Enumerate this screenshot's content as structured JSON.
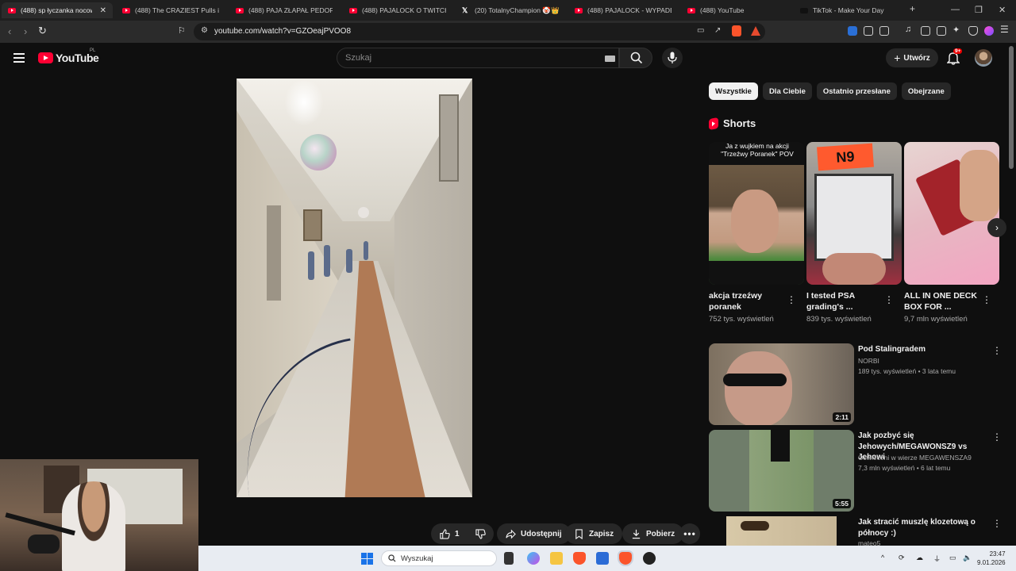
{
  "browser": {
    "tabs": [
      {
        "label": "(488) sp łyczanka nocowan",
        "active": true,
        "icon": "youtube-icon"
      },
      {
        "label": "(488) The CRAZIEST Pulls in TC",
        "icon": "youtube-icon"
      },
      {
        "label": "(488) PAJA ZŁAPAŁ PEDOFILA",
        "icon": "youtube-icon"
      },
      {
        "label": "(488) PAJALOCK O TWITCH.TV",
        "icon": "youtube-icon"
      },
      {
        "label": "(20) TotalnyChampion 🤡👑 o",
        "icon": "x-icon"
      },
      {
        "label": "(488) PAJALOCK - WYPADEK N",
        "icon": "youtube-icon"
      },
      {
        "label": "(488) YouTube",
        "icon": "youtube-icon"
      },
      {
        "label": "TikTok - Make Your Day",
        "icon": "tiktok-icon"
      }
    ],
    "new_tab": "+",
    "url": "youtube.com/watch?v=GZOeajPVOO8"
  },
  "youtube": {
    "logo_text": "YouTube",
    "country_code": "PL",
    "search_placeholder": "Szukaj",
    "create_label": "Utwórz",
    "notifications_badge": "9+"
  },
  "video": {
    "likes": "1",
    "actions": {
      "share": "Udostępnij",
      "save": "Zapisz",
      "download": "Pobierz"
    }
  },
  "sidebar": {
    "chips": [
      "Wszystkie",
      "Dla Ciebie",
      "Ostatnio przesłane",
      "Obejrzane"
    ],
    "active_chip": "Wszystkie",
    "shorts_title": "Shorts",
    "shorts": [
      {
        "title": "akcja trzeźwy poranek",
        "views": "752 tys. wyświetleń",
        "overlay": "Ja z wujkiem na akcji \"Trzeźwy Poranek\" POV"
      },
      {
        "title": "I tested PSA grading's ...",
        "views": "839 tys. wyświetleń",
        "overlay": "N9"
      },
      {
        "title": "ALL IN ONE DECK BOX FOR ...",
        "views": "9,7 mln wyświetleń",
        "overlay": ""
      }
    ],
    "videos": [
      {
        "title": "Pod Stalingradem",
        "channel": "NORBI",
        "meta": "189 tys. wyświetleń • 3 lata temu",
        "duration": "2:11"
      },
      {
        "title": "Jak pozbyć się Jehowych/MEGAWONSZ9 vs Jehowi",
        "channel": "Oświeceni w wierze MEGAWENSZA9",
        "meta": "7,3 mln wyświetleń • 6 lat temu",
        "duration": "5:55"
      },
      {
        "title": "Jak stracić muszlę klozetową o północy :)",
        "channel": "mateo5",
        "meta": "",
        "duration": ""
      }
    ]
  },
  "taskbar": {
    "search_label": "Wyszukaj",
    "time": "23:47",
    "date": "9.01.2026"
  }
}
